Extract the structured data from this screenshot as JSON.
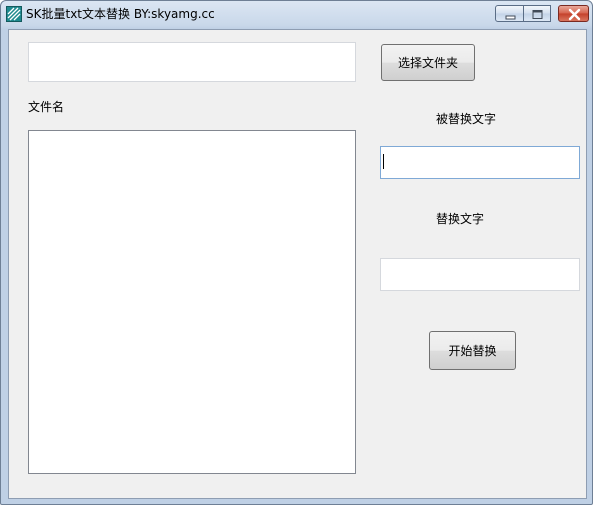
{
  "window": {
    "title": "SK批量txt文本替换 BY:skyamg.cc",
    "icon": "app-icon",
    "controls": [
      "minimize-icon",
      "maximize-icon",
      "close-icon"
    ]
  },
  "folder": {
    "path_value": "",
    "select_button_label": "选择文件夹"
  },
  "file_list": {
    "label": "文件名",
    "items": []
  },
  "find": {
    "label": "被替换文字",
    "value": ""
  },
  "replace": {
    "label": "替换文字",
    "value": ""
  },
  "actions": {
    "start_label": "开始替换"
  },
  "colors": {
    "client_background": "#f0f0f0",
    "titlebar": "#c9d8ea",
    "close_button": "#c4402a",
    "focus_border": "#7fa9d6"
  }
}
